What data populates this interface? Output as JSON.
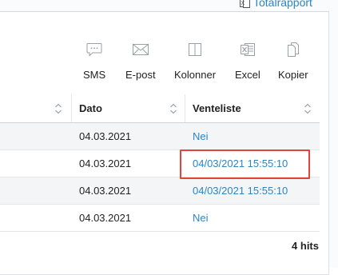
{
  "top_link": {
    "label": "Totalrapport",
    "icon": "excel-small-icon"
  },
  "toolbar": {
    "items": [
      {
        "label": "SMS",
        "icon": "sms-icon"
      },
      {
        "label": "E-post",
        "icon": "envelope-icon"
      },
      {
        "label": "Kolonner",
        "icon": "columns-icon"
      },
      {
        "label": "Excel",
        "icon": "excel-icon"
      },
      {
        "label": "Kopier",
        "icon": "copy-icon"
      }
    ]
  },
  "table": {
    "columns": [
      "Dato",
      "Venteliste"
    ],
    "rows": [
      {
        "dato": "04.03.2021",
        "venteliste": "Nei"
      },
      {
        "dato": "04.03.2021",
        "venteliste": "04/03/2021 15:55:10"
      },
      {
        "dato": "04.03.2021",
        "venteliste": "04/03/2021 15:55:10"
      },
      {
        "dato": "04.03.2021",
        "venteliste": "Nei"
      }
    ]
  },
  "footer": {
    "hits": "4 hits"
  },
  "colors": {
    "link": "#2b86c5",
    "highlight": "#e0443b",
    "row_shade": "#f4f5f6"
  }
}
